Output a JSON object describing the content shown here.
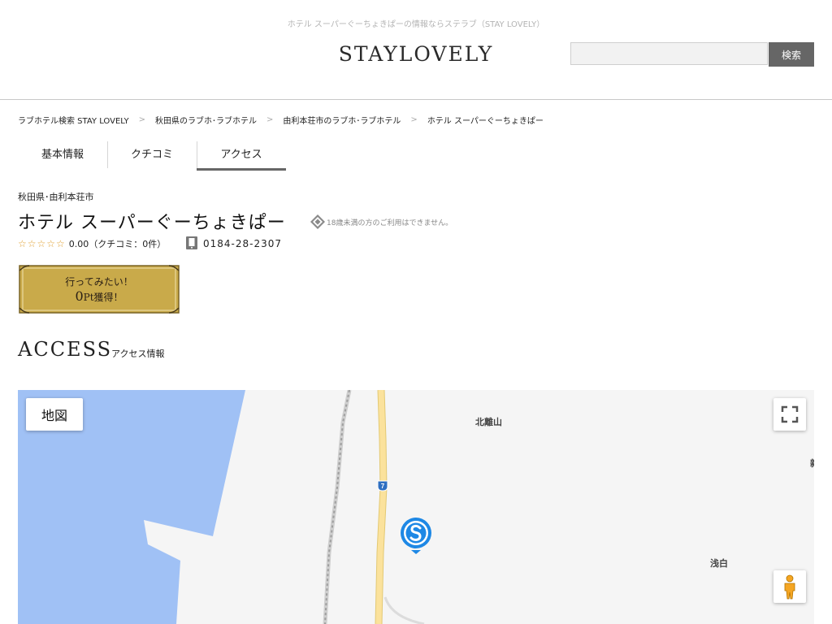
{
  "header": {
    "tagline": "ホテル スーパーぐーちょきぱーの情報ならステラブ（STAY LOVELY）",
    "logo": "STAYLOVELY",
    "search_placeholder": "",
    "search_button": "検索"
  },
  "breadcrumb": [
    "ラブホテル検索 STAY LOVELY",
    "秋田県のラブホ･ラブホテル",
    "由利本荘市のラブホ･ラブホテル",
    "ホテル スーパーぐーちょきぱー"
  ],
  "breadcrumb_separator": ">",
  "tabs": [
    {
      "label": "基本情報",
      "active": false
    },
    {
      "label": "クチコミ",
      "active": false
    },
    {
      "label": "アクセス",
      "active": true
    }
  ],
  "hotel": {
    "region": "秋田県･由利本荘市",
    "name": "ホテル スーパーぐーちょきぱー",
    "age_notice": "18歳未満の方のご利用はできません。",
    "rating_stars": "☆☆☆☆☆",
    "rating_text": "0.00（クチコミ：0件）",
    "rating_value": 0.0,
    "review_count": 0,
    "phone": "0184-28-2307"
  },
  "wish_button": {
    "label": "行ってみたい！",
    "points_value": "0",
    "points_unit": "Pt",
    "points_suffix": "獲得！"
  },
  "access": {
    "title": "ACCESS",
    "subtitle": "アクセス情報"
  },
  "map": {
    "type_button": "地図",
    "labels": {
      "north": "北離山",
      "east": "浅白",
      "edge": "新"
    },
    "route_number": "7",
    "colors": {
      "water": "#a0c1f5",
      "land": "#f5f5f5",
      "road": "#fbe29c",
      "pin": "#1e88e5"
    },
    "icons": {
      "fullscreen": "fullscreen-icon",
      "pegman": "pegman-icon",
      "pin": "hotel-pin-icon"
    }
  },
  "colors": {
    "accent": "#666666",
    "star": "#e0a030",
    "wish_gold": "#c9aa4a"
  }
}
